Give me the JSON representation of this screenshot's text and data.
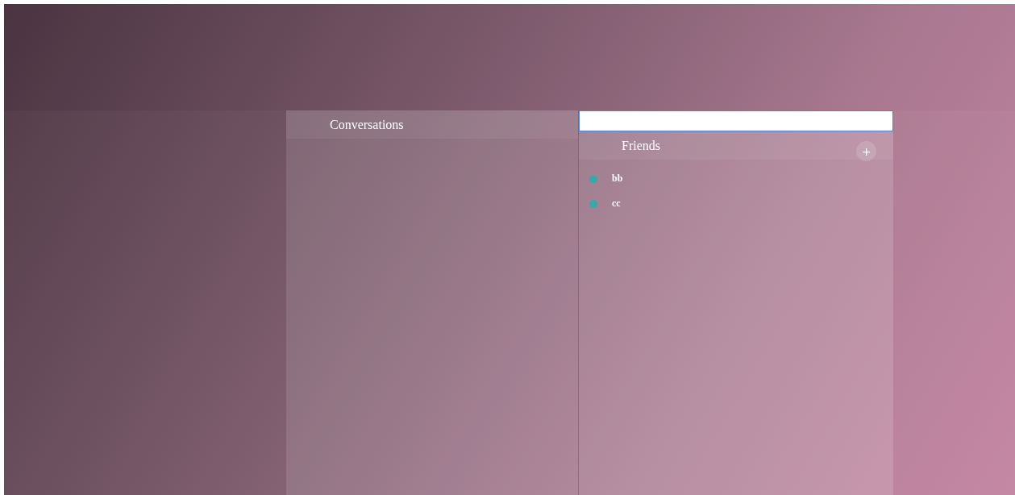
{
  "conversations": {
    "title": "Conversations"
  },
  "friends": {
    "title": "Friends",
    "add_button": "+",
    "items": [
      {
        "name": "bb",
        "online": true
      },
      {
        "name": "cc",
        "online": true
      }
    ]
  }
}
